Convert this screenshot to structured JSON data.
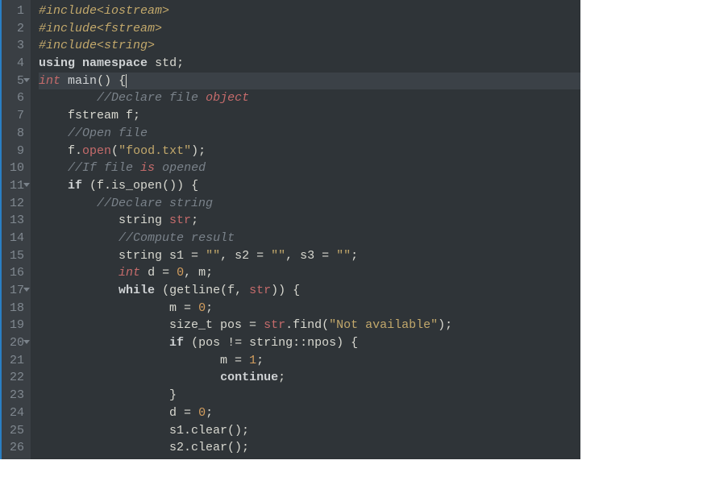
{
  "editor": {
    "highlighted_line": 5,
    "fold_lines": [
      5,
      11,
      17,
      20
    ],
    "lines": [
      {
        "num": 1,
        "tokens": [
          {
            "cls": "tok-pre",
            "t": "#include<iostream>"
          }
        ]
      },
      {
        "num": 2,
        "tokens": [
          {
            "cls": "tok-pre",
            "t": "#include<fstream>"
          }
        ]
      },
      {
        "num": 3,
        "tokens": [
          {
            "cls": "tok-pre",
            "t": "#include<string>"
          }
        ]
      },
      {
        "num": 4,
        "tokens": [
          {
            "cls": "tok-kw",
            "t": "using"
          },
          {
            "cls": "tok-id",
            "t": " "
          },
          {
            "cls": "tok-kw",
            "t": "namespace"
          },
          {
            "cls": "tok-id",
            "t": " std;"
          }
        ]
      },
      {
        "num": 5,
        "tokens": [
          {
            "cls": "tok-type",
            "t": "int"
          },
          {
            "cls": "tok-id",
            "t": " "
          },
          {
            "cls": "tok-func",
            "t": "main"
          },
          {
            "cls": "tok-id",
            "t": "() {"
          },
          {
            "cls": "cursor",
            "t": ""
          }
        ]
      },
      {
        "num": 6,
        "tokens": [
          {
            "cls": "tok-id",
            "t": "        "
          },
          {
            "cls": "tok-com",
            "t": "//Declare file "
          },
          {
            "cls": "tok-err",
            "t": "object"
          }
        ]
      },
      {
        "num": 7,
        "tokens": [
          {
            "cls": "tok-id",
            "t": "    fstream f;"
          }
        ]
      },
      {
        "num": 8,
        "tokens": [
          {
            "cls": "tok-id",
            "t": "    "
          },
          {
            "cls": "tok-com",
            "t": "//Open file"
          }
        ]
      },
      {
        "num": 9,
        "tokens": [
          {
            "cls": "tok-id",
            "t": "    f."
          },
          {
            "cls": "tok-call",
            "t": "open"
          },
          {
            "cls": "tok-id",
            "t": "("
          },
          {
            "cls": "tok-str",
            "t": "\"food.txt\""
          },
          {
            "cls": "tok-id",
            "t": ");"
          }
        ]
      },
      {
        "num": 10,
        "tokens": [
          {
            "cls": "tok-id",
            "t": "    "
          },
          {
            "cls": "tok-com",
            "t": "//If file "
          },
          {
            "cls": "tok-err",
            "t": "is"
          },
          {
            "cls": "tok-com",
            "t": " opened"
          }
        ]
      },
      {
        "num": 11,
        "tokens": [
          {
            "cls": "tok-id",
            "t": "    "
          },
          {
            "cls": "tok-kw",
            "t": "if"
          },
          {
            "cls": "tok-id",
            "t": " (f.is_open()) {"
          }
        ]
      },
      {
        "num": 12,
        "tokens": [
          {
            "cls": "tok-id",
            "t": "        "
          },
          {
            "cls": "tok-com",
            "t": "//Declare string"
          }
        ]
      },
      {
        "num": 13,
        "tokens": [
          {
            "cls": "tok-id",
            "t": "           string "
          },
          {
            "cls": "tok-var",
            "t": "str"
          },
          {
            "cls": "tok-id",
            "t": ";"
          }
        ]
      },
      {
        "num": 14,
        "tokens": [
          {
            "cls": "tok-id",
            "t": "           "
          },
          {
            "cls": "tok-com",
            "t": "//Compute result"
          }
        ]
      },
      {
        "num": 15,
        "tokens": [
          {
            "cls": "tok-id",
            "t": "           string s1 = "
          },
          {
            "cls": "tok-str",
            "t": "\"\""
          },
          {
            "cls": "tok-id",
            "t": ", s2 = "
          },
          {
            "cls": "tok-str",
            "t": "\"\""
          },
          {
            "cls": "tok-id",
            "t": ", s3 = "
          },
          {
            "cls": "tok-str",
            "t": "\"\""
          },
          {
            "cls": "tok-id",
            "t": ";"
          }
        ]
      },
      {
        "num": 16,
        "tokens": [
          {
            "cls": "tok-id",
            "t": "           "
          },
          {
            "cls": "tok-type",
            "t": "int"
          },
          {
            "cls": "tok-id",
            "t": " d = "
          },
          {
            "cls": "tok-num",
            "t": "0"
          },
          {
            "cls": "tok-id",
            "t": ", m;"
          }
        ]
      },
      {
        "num": 17,
        "tokens": [
          {
            "cls": "tok-id",
            "t": "           "
          },
          {
            "cls": "tok-kw",
            "t": "while"
          },
          {
            "cls": "tok-id",
            "t": " (getline(f, "
          },
          {
            "cls": "tok-var",
            "t": "str"
          },
          {
            "cls": "tok-id",
            "t": ")) {"
          }
        ]
      },
      {
        "num": 18,
        "tokens": [
          {
            "cls": "tok-id",
            "t": "                  m = "
          },
          {
            "cls": "tok-num",
            "t": "0"
          },
          {
            "cls": "tok-id",
            "t": ";"
          }
        ]
      },
      {
        "num": 19,
        "tokens": [
          {
            "cls": "tok-id",
            "t": "                  size_t pos = "
          },
          {
            "cls": "tok-var",
            "t": "str"
          },
          {
            "cls": "tok-id",
            "t": ".find("
          },
          {
            "cls": "tok-str",
            "t": "\"Not available\""
          },
          {
            "cls": "tok-id",
            "t": ");"
          }
        ]
      },
      {
        "num": 20,
        "tokens": [
          {
            "cls": "tok-id",
            "t": "                  "
          },
          {
            "cls": "tok-kw",
            "t": "if"
          },
          {
            "cls": "tok-id",
            "t": " (pos != string::npos) {"
          }
        ]
      },
      {
        "num": 21,
        "tokens": [
          {
            "cls": "tok-id",
            "t": "                         m = "
          },
          {
            "cls": "tok-num",
            "t": "1"
          },
          {
            "cls": "tok-id",
            "t": ";"
          }
        ]
      },
      {
        "num": 22,
        "tokens": [
          {
            "cls": "tok-id",
            "t": "                         "
          },
          {
            "cls": "tok-kw",
            "t": "continue"
          },
          {
            "cls": "tok-id",
            "t": ";"
          }
        ]
      },
      {
        "num": 23,
        "tokens": [
          {
            "cls": "tok-id",
            "t": "                  }"
          }
        ]
      },
      {
        "num": 24,
        "tokens": [
          {
            "cls": "tok-id",
            "t": "                  d = "
          },
          {
            "cls": "tok-num",
            "t": "0"
          },
          {
            "cls": "tok-id",
            "t": ";"
          }
        ]
      },
      {
        "num": 25,
        "tokens": [
          {
            "cls": "tok-id",
            "t": "                  s1.clear();"
          }
        ]
      },
      {
        "num": 26,
        "tokens": [
          {
            "cls": "tok-id",
            "t": "                  s2.clear();"
          }
        ]
      }
    ]
  }
}
